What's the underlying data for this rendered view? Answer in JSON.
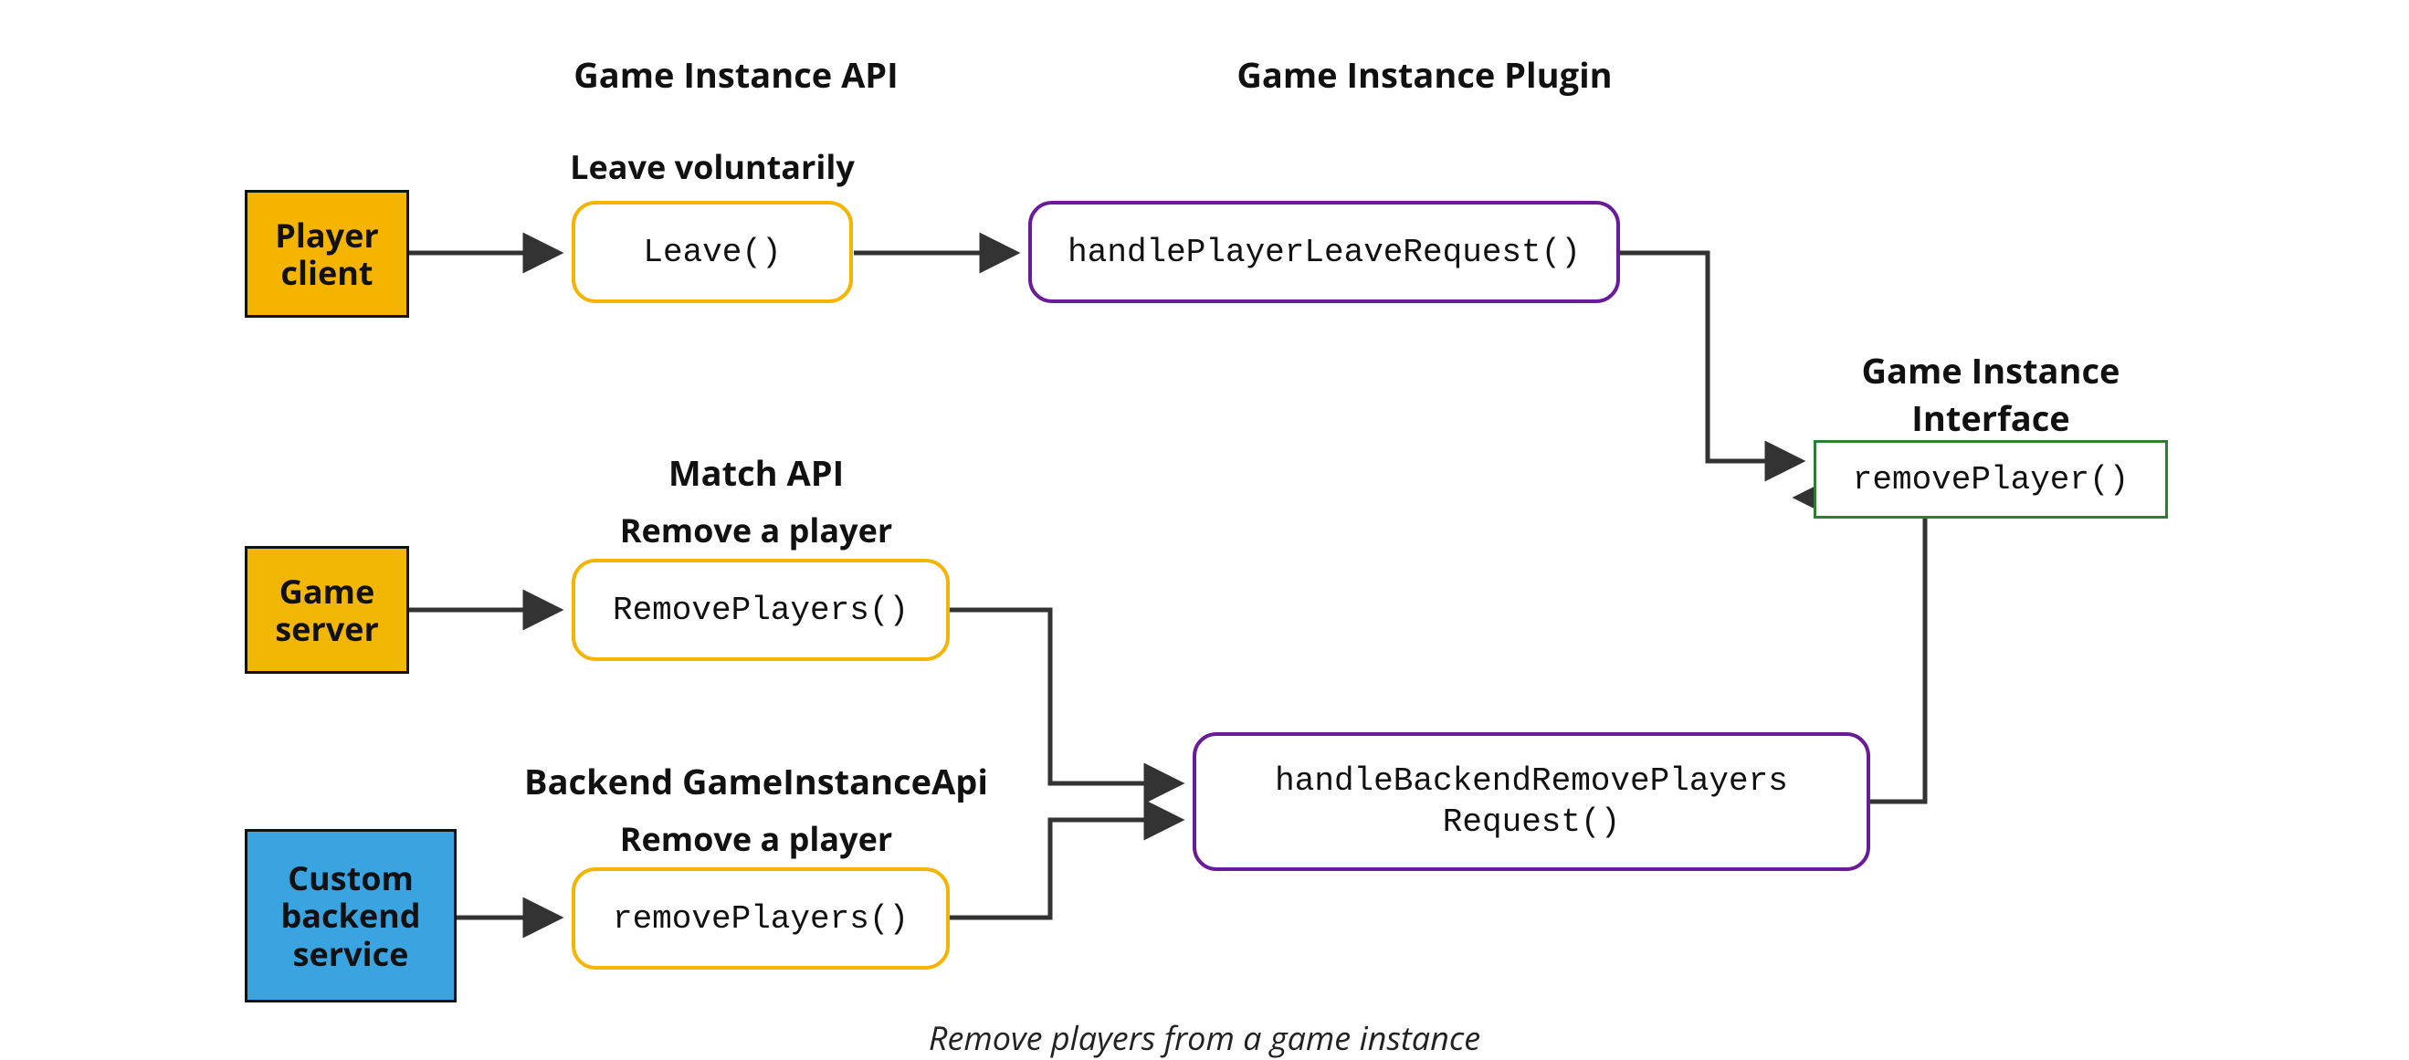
{
  "headings": {
    "game_instance_api": "Game Instance API",
    "game_instance_plugin": "Game Instance Plugin",
    "match_api": "Match API",
    "backend_game_instance_api": "Backend GameInstanceApi",
    "game_instance_interface": "Game Instance Interface"
  },
  "subheadings": {
    "leave_voluntarily": "Leave voluntarily",
    "remove_a_player_1": "Remove a player",
    "remove_a_player_2": "Remove a player"
  },
  "sources": {
    "player_client": "Player client",
    "game_server": "Game server",
    "custom_backend_service": "Custom backend service"
  },
  "api_nodes": {
    "leave": "Leave()",
    "remove_players_pascal": "RemovePlayers()",
    "remove_players_camel": "removePlayers()"
  },
  "plugin_nodes": {
    "handle_player_leave_request": "handlePlayerLeaveRequest()",
    "handle_backend_remove_players_request": "handleBackendRemovePlayers Request()"
  },
  "interface_nodes": {
    "remove_player": "removePlayer()"
  },
  "caption": "Remove players from a game instance",
  "colors": {
    "source_yellow": "#f4b400",
    "source_blue": "#3aa4e0",
    "border_yellow": "#f4b400",
    "border_purple": "#6a1b9a",
    "border_green": "#2e7d32",
    "arrow": "#333333"
  }
}
